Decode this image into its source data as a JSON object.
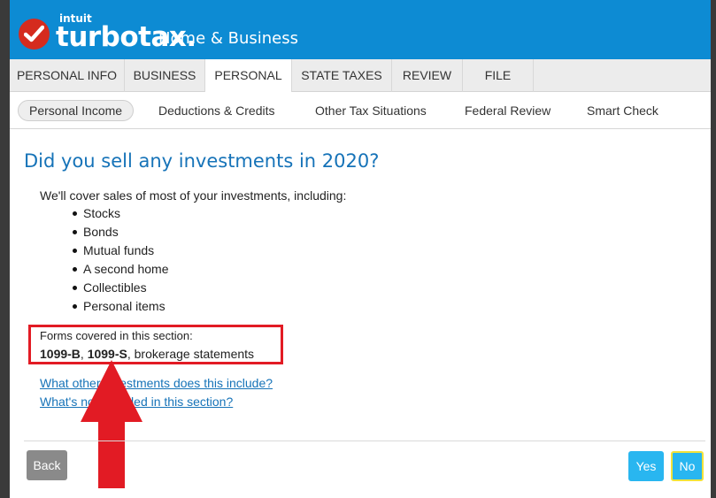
{
  "header": {
    "intuit_label": "intuit",
    "brand": "turbotax.",
    "edition": "Home & Business"
  },
  "tabs": [
    {
      "label": "PERSONAL INFO"
    },
    {
      "label": "BUSINESS"
    },
    {
      "label": "PERSONAL"
    },
    {
      "label": "STATE TAXES"
    },
    {
      "label": "REVIEW"
    },
    {
      "label": "FILE"
    }
  ],
  "subnav": [
    {
      "label": "Personal Income"
    },
    {
      "label": "Deductions & Credits"
    },
    {
      "label": "Other Tax Situations"
    },
    {
      "label": "Federal Review"
    },
    {
      "label": "Smart Check"
    }
  ],
  "main": {
    "title": "Did you sell any investments in 2020?",
    "intro": "We'll cover sales of most of your investments, including:",
    "items": [
      "Stocks",
      "Bonds",
      "Mutual funds",
      "A second home",
      "Collectibles",
      "Personal items"
    ],
    "forms_label": "Forms covered in this section:",
    "form1": "1099-B",
    "sep": ", ",
    "form2": "1099-S",
    "forms_rest": ", brokerage statements",
    "link1": "What other investments does this include?",
    "link2": "What's not included in this section?"
  },
  "footer": {
    "back_label": "Back",
    "yes_label": "Yes",
    "no_label": "No"
  },
  "colors": {
    "header_blue": "#0d8bd3",
    "title_blue": "#1673b8",
    "button_blue": "#29b6f0",
    "annotation_red": "#e21b24"
  }
}
